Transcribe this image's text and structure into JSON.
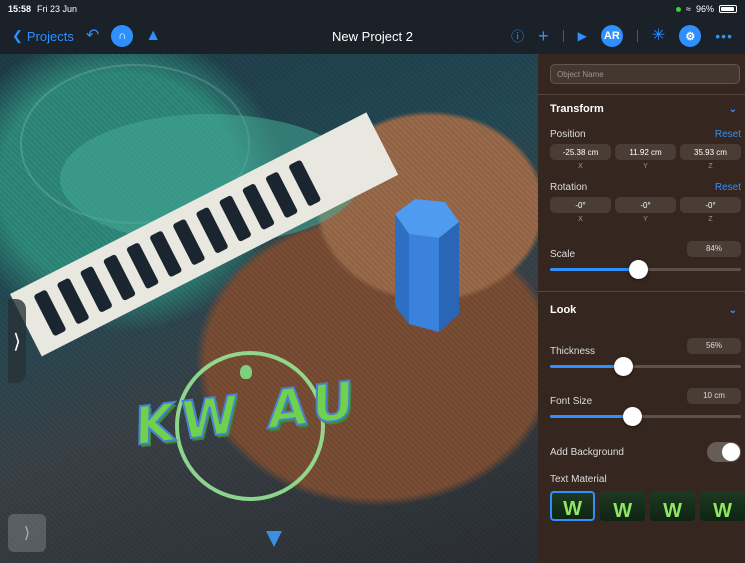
{
  "status": {
    "time": "15:58",
    "date": "Fri 23 Jun",
    "battery": "96%",
    "battery_fraction": 0.96
  },
  "toolbar": {
    "back_label": "Projects",
    "title": "New Project 2",
    "ar_label": "AR"
  },
  "ar_view": {
    "text": "KW AU"
  },
  "inspector": {
    "object_name_placeholder": "Object Name",
    "transform": {
      "title": "Transform",
      "position": {
        "label": "Position",
        "reset": "Reset",
        "x": "-25.38 cm",
        "y": "11.92 cm",
        "z": "35.93 cm"
      },
      "rotation": {
        "label": "Rotation",
        "reset": "Reset",
        "x": "-0°",
        "y": "-0°",
        "z": "-0°"
      },
      "axes": {
        "x": "X",
        "y": "Y",
        "z": "Z"
      },
      "scale": {
        "label": "Scale",
        "value": "84%",
        "fraction": 0.46
      }
    },
    "look": {
      "title": "Look",
      "thickness": {
        "label": "Thickness",
        "value": "56%",
        "fraction": 0.38
      },
      "font_size": {
        "label": "Font Size",
        "value": "10 cm",
        "fraction": 0.43
      },
      "add_background": {
        "label": "Add Background",
        "on": false
      },
      "text_material": {
        "label": "Text Material",
        "swatch_glyph": "W"
      }
    }
  },
  "colors": {
    "accent": "#2e8fff",
    "panel": "#3a2a22",
    "toolbar": "#1a2128",
    "text3d": "#6fd14e"
  }
}
